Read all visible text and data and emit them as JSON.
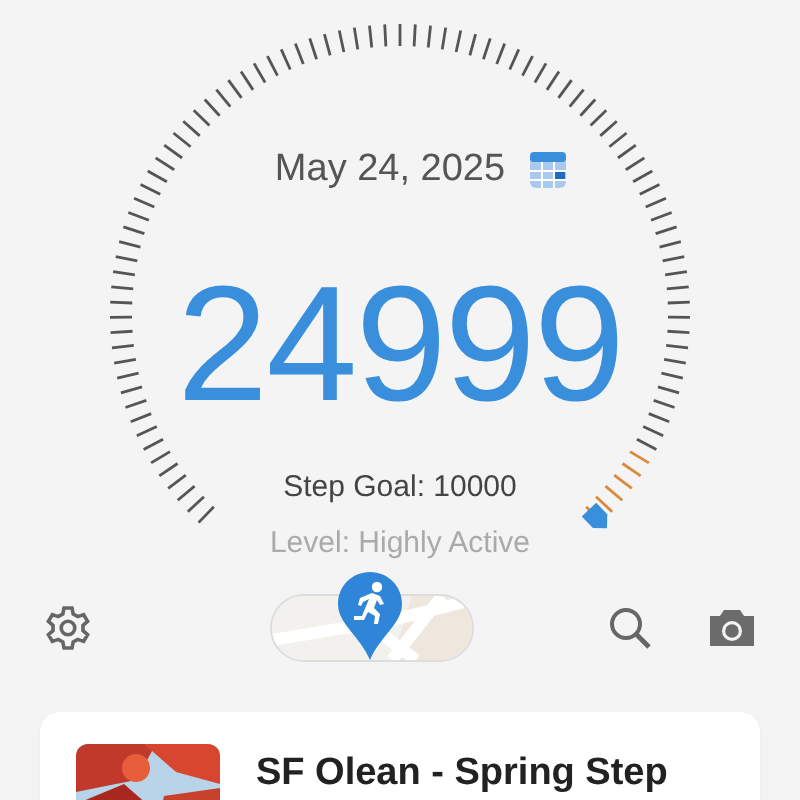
{
  "date": "May 24, 2025",
  "steps": "24999",
  "goal": "Step Goal: 10000",
  "activity_level": "Level: Highly Active",
  "card": {
    "title": "SF Olean - Spring Step"
  }
}
